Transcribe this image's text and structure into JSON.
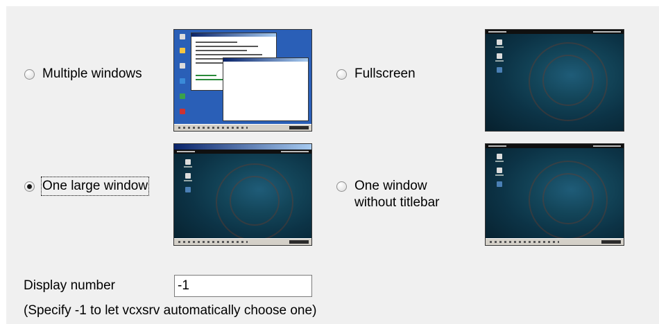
{
  "display_modes": {
    "multiple_windows": {
      "label": "Multiple windows",
      "checked": false
    },
    "fullscreen": {
      "label": "Fullscreen",
      "checked": false
    },
    "one_large_window": {
      "label": "One large window",
      "checked": true
    },
    "one_window_no_titlebar": {
      "label_line1": "One window",
      "label_line2": "without titlebar",
      "checked": false
    }
  },
  "display_number": {
    "label": "Display number",
    "value": "-1",
    "hint": "(Specify -1 to let vcxsrv automatically choose one)"
  },
  "colors": {
    "panel_bg": "#f0f0f0",
    "desktop_dark": "#0c3346",
    "desktop_blue": "#2a5fb7"
  }
}
